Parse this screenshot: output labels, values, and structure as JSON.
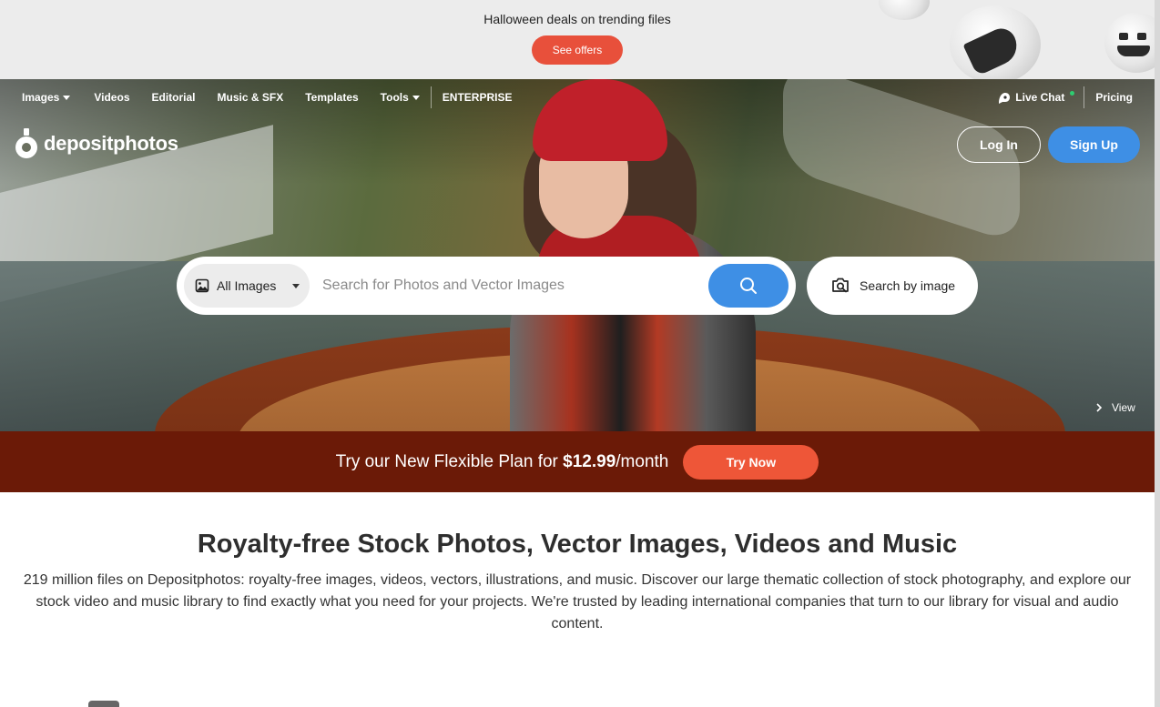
{
  "promo": {
    "text": "Halloween deals on trending files",
    "button": "See offers"
  },
  "nav": {
    "items": [
      {
        "label": "Images",
        "dropdown": true
      },
      {
        "label": "Videos",
        "dropdown": false
      },
      {
        "label": "Editorial",
        "dropdown": false
      },
      {
        "label": "Music & SFX",
        "dropdown": false
      },
      {
        "label": "Templates",
        "dropdown": false
      },
      {
        "label": "Tools",
        "dropdown": true
      }
    ],
    "enterprise": "ENTERPRISE",
    "live_chat": "Live Chat",
    "pricing": "Pricing"
  },
  "logo": {
    "text": "depositphotos"
  },
  "auth": {
    "login": "Log In",
    "signup": "Sign Up"
  },
  "search": {
    "type_label": "All Images",
    "placeholder": "Search for Photos and Vector Images",
    "by_image": "Search by image"
  },
  "hero": {
    "view_label": "View"
  },
  "flex_plan": {
    "text_before": "Try our New Flexible Plan for ",
    "price": "$12.99",
    "text_after": "/month",
    "button": "Try Now"
  },
  "content": {
    "headline": "Royalty-free Stock Photos, Vector Images, Videos and Music",
    "description": "219 million files on Depositphotos: royalty-free images, videos, vectors, illustrations, and music. Discover our large thematic collection of stock photography, and explore our stock video and music library to find exactly what you need for your projects. We're trusted by leading international companies that turn to our library for visual and audio content."
  },
  "colors": {
    "accent_blue": "#3e8fe5",
    "promo_red": "#e8503b",
    "flex_bar": "#6b1a07",
    "try_now": "#ee5638"
  }
}
